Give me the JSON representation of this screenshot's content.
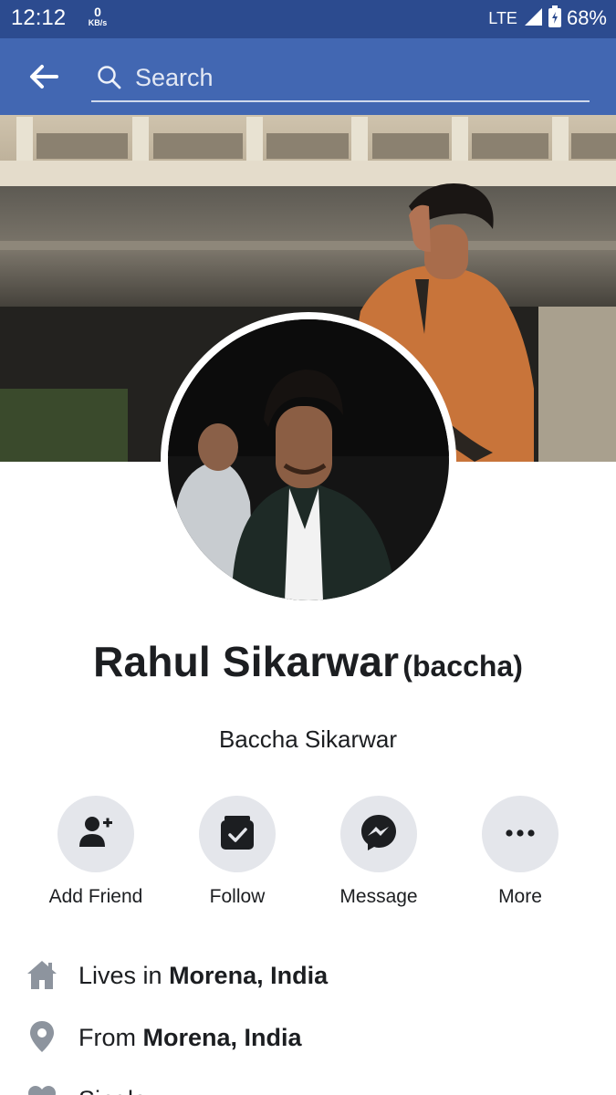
{
  "status_bar": {
    "time": "12:12",
    "net_speed_value": "0",
    "net_speed_unit": "KB/s",
    "network": "LTE",
    "battery": "68%"
  },
  "app_bar": {
    "search_placeholder": "Search"
  },
  "profile": {
    "name": "Rahul Sikarwar",
    "alternate_name": "(baccha)",
    "subname": "Baccha Sikarwar"
  },
  "actions": [
    {
      "label": "Add Friend",
      "icon": "add-friend-icon"
    },
    {
      "label": "Follow",
      "icon": "follow-icon"
    },
    {
      "label": "Message",
      "icon": "messenger-icon"
    },
    {
      "label": "More",
      "icon": "more-icon"
    }
  ],
  "info": [
    {
      "prefix": "Lives in ",
      "value": "Morena, India",
      "icon": "home-icon"
    },
    {
      "prefix": "From ",
      "value": "Morena, India",
      "icon": "location-pin-icon"
    },
    {
      "prefix": "Single",
      "value": "",
      "icon": "heart-icon"
    }
  ],
  "colors": {
    "status_bar": "#2c4b8f",
    "app_bar": "#4267b2",
    "button_bg": "#e4e6eb",
    "icon_gray": "#8d949e"
  }
}
